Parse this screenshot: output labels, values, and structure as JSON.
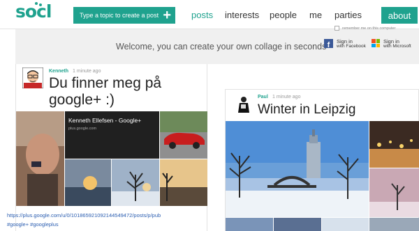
{
  "header": {
    "logo": "socl",
    "create_label": "Type a topic to create a post",
    "create_icon": "plus-icon",
    "nav": [
      "posts",
      "interests",
      "people",
      "me",
      "parties"
    ],
    "active_nav": "posts",
    "about_label": "about",
    "accent_color": "#1fa28e"
  },
  "welcome": {
    "text": "Welcome, you can create your own collage in seconds",
    "facebook": {
      "line1": "Sign in",
      "line2": "with Facebook"
    },
    "microsoft": {
      "line1": "Sign in",
      "line2": "with Microsoft"
    },
    "remember": "remember me on this computer"
  },
  "posts": [
    {
      "author": "Kenneth",
      "time": "1 minute ago",
      "title_line1": "Du finner meg på",
      "title_line2": "google+ :)",
      "card_title": "Kenneth Ellefsen - Google+",
      "card_url": "plus.google.com",
      "link": "https://plus.google.com/u/0/101865921092144549472/posts/p/pub",
      "tags": [
        "#google+",
        "#googleplus"
      ]
    },
    {
      "author": "Paul",
      "time": "1 minute ago",
      "title": "Winter in Leipzig"
    }
  ]
}
